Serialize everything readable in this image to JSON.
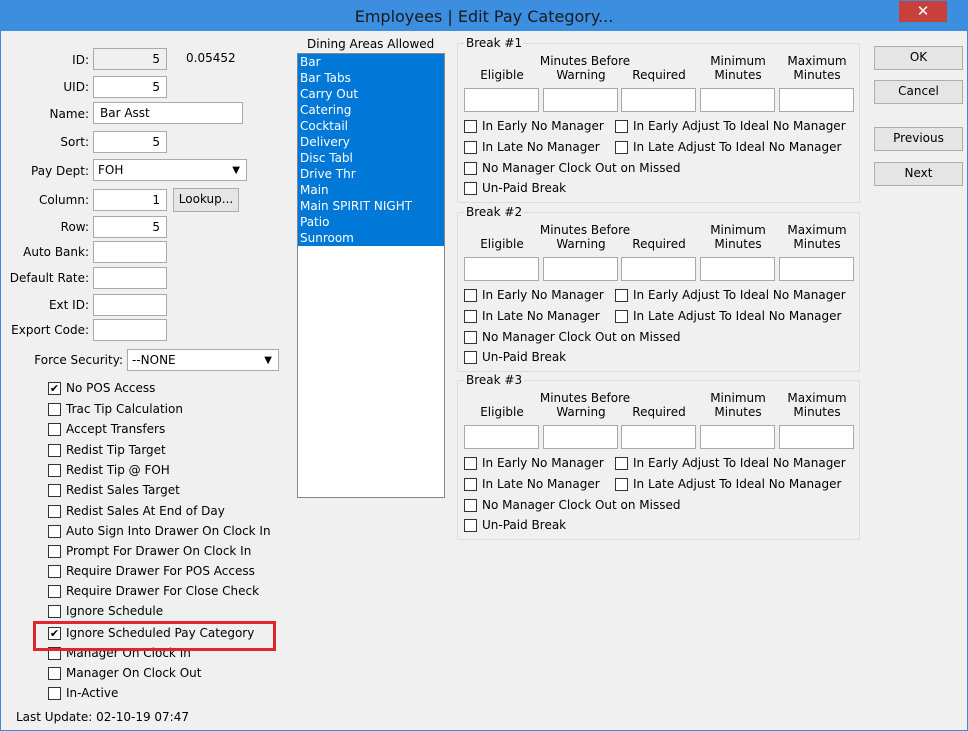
{
  "window": {
    "title": "Employees | Edit Pay Category...",
    "close": "✕"
  },
  "form": {
    "id_label": "ID:",
    "id_value": "5",
    "id_extra": "0.05452",
    "uid_label": "UID:",
    "uid_value": "5",
    "name_label": "Name:",
    "name_value": "Bar Asst",
    "sort_label": "Sort:",
    "sort_value": "5",
    "paydept_label": "Pay Dept:",
    "paydept_value": "FOH",
    "column_label": "Column:",
    "column_value": "1",
    "lookup_button": "Lookup...",
    "row_label": "Row:",
    "row_value": "5",
    "autobank_label": "Auto Bank:",
    "autobank_value": "",
    "defaultrate_label": "Default Rate:",
    "defaultrate_value": "",
    "extid_label": "Ext ID:",
    "extid_value": "",
    "exportcode_label": "Export Code:",
    "exportcode_value": "",
    "forcesecurity_label": "Force Security:",
    "forcesecurity_value": "--NONE"
  },
  "checkboxes": [
    {
      "label": "No POS Access",
      "checked": true
    },
    {
      "label": "Trac Tip Calculation",
      "checked": false
    },
    {
      "label": "Accept Transfers",
      "checked": false
    },
    {
      "label": "Redist Tip Target",
      "checked": false
    },
    {
      "label": "Redist Tip @ FOH",
      "checked": false
    },
    {
      "label": "Redist Sales Target",
      "checked": false
    },
    {
      "label": "Redist Sales At End of Day",
      "checked": false
    },
    {
      "label": "Auto Sign Into Drawer On Clock In",
      "checked": false
    },
    {
      "label": "Prompt For Drawer On Clock In",
      "checked": false
    },
    {
      "label": "Require Drawer For POS Access",
      "checked": false
    },
    {
      "label": "Require Drawer For Close Check",
      "checked": false
    },
    {
      "label": "Ignore Schedule",
      "checked": false
    },
    {
      "label": "Ignore Scheduled Pay Category",
      "checked": true
    },
    {
      "label": "Manager On Clock In",
      "checked": false
    },
    {
      "label": "Manager On Clock Out",
      "checked": false
    },
    {
      "label": "In-Active",
      "checked": false
    }
  ],
  "last_update": "Last Update: 02-10-19 07:47",
  "dining": {
    "title": "Dining Areas Allowed",
    "items": [
      "Bar",
      "Bar Tabs",
      "Carry Out",
      "Catering",
      "Cocktail",
      "Delivery",
      "Disc Tabl",
      "Drive Thr",
      "Main",
      "Main SPIRIT NIGHT",
      "Patio",
      "Sunroom"
    ]
  },
  "breaks": {
    "col_eligible": "Eligible",
    "col_minutes_before": "Minutes Before",
    "col_warning": "Warning",
    "col_required": "Required",
    "col_minimum": "Minimum",
    "col_maximum": "Maximum",
    "col_minutes": "Minutes",
    "opt_early_no_manager": "In Early No Manager",
    "opt_early_adjust": "In Early Adjust To Ideal No Manager",
    "opt_late_no_manager": "In Late No Manager",
    "opt_late_adjust": "In Late Adjust To Ideal No Manager",
    "opt_no_manager_clockout": "No Manager Clock Out on Missed",
    "opt_unpaid": "Un-Paid Break",
    "titles": [
      "Break #1",
      "Break #2",
      "Break #3"
    ]
  },
  "buttons": {
    "ok": "OK",
    "cancel": "Cancel",
    "previous": "Previous",
    "next": "Next"
  },
  "colors": {
    "selection": "#0078d7",
    "titlebar": "#3c8fe0",
    "highlight": "#e0252b"
  }
}
